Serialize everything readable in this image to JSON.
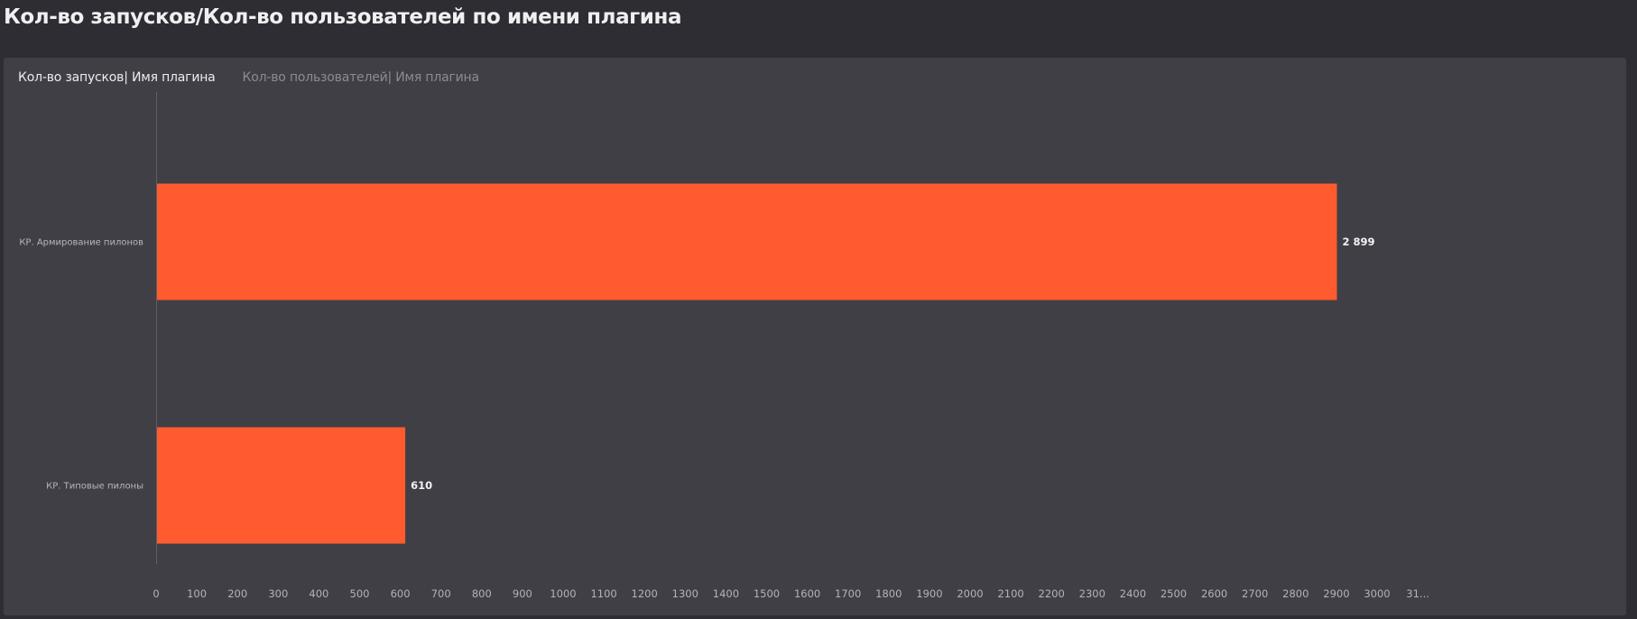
{
  "page": {
    "title": "Кол-во запусков/Кол-во пользователей по имени плагина"
  },
  "tabs": [
    {
      "label": "Кол-во запусков| Имя плагина",
      "active": true
    },
    {
      "label": "Кол-во пользователей| Имя плагина",
      "active": false
    }
  ],
  "colors": {
    "bar": "#ff5b2e",
    "background": "#2e2d33",
    "panel": "#403f46"
  },
  "chart_data": {
    "type": "bar",
    "orientation": "horizontal",
    "categories": [
      "КР. Армирование пилонов",
      "КР. Типовые пилоны"
    ],
    "values": [
      2899,
      610
    ],
    "value_labels": [
      "2 899",
      "610"
    ],
    "xlim": [
      0,
      3150
    ],
    "x_ticks": [
      0,
      100,
      200,
      300,
      400,
      500,
      600,
      700,
      800,
      900,
      1000,
      1100,
      1200,
      1300,
      1400,
      1500,
      1600,
      1700,
      1800,
      1900,
      2000,
      2100,
      2200,
      2300,
      2400,
      2500,
      2600,
      2700,
      2800,
      2900,
      3000,
      3100
    ],
    "x_tick_labels": [
      "0",
      "100",
      "200",
      "300",
      "400",
      "500",
      "600",
      "700",
      "800",
      "900",
      "1000",
      "1100",
      "1200",
      "1300",
      "1400",
      "1500",
      "1600",
      "1700",
      "1800",
      "1900",
      "2000",
      "2100",
      "2200",
      "2300",
      "2400",
      "2500",
      "2600",
      "2700",
      "2800",
      "2900",
      "3000",
      "31..."
    ],
    "grid": false,
    "legend": "none"
  }
}
